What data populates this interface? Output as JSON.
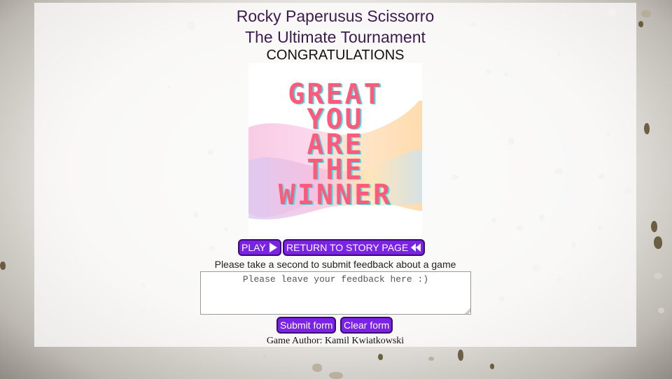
{
  "header": {
    "title_line1": "Rocky Paperusus Scissorro",
    "title_line2": "The Ultimate Tournament",
    "status": "CONGRATULATIONS"
  },
  "winner_image": {
    "lines": [
      "GREAT",
      "YOU",
      "ARE",
      "THE",
      "WINNER"
    ]
  },
  "nav": {
    "play_label": "PLAY",
    "play_icon": "play-icon",
    "return_label": "RETURN TO STORY PAGE",
    "return_icon": "rewind-icon"
  },
  "feedback": {
    "prompt": "Please take a second to submit feedback about a game",
    "placeholder": "Please leave your feedback here :)",
    "value": ""
  },
  "form_buttons": {
    "submit_label": "Submit form",
    "clear_label": "Clear form"
  },
  "footer": {
    "author": "Game Author: Kamil Kwiatkowski"
  },
  "colors": {
    "button_bg": "#7a22e6",
    "title": "#3f1a4f",
    "winner_text": "#ff5a7a"
  }
}
